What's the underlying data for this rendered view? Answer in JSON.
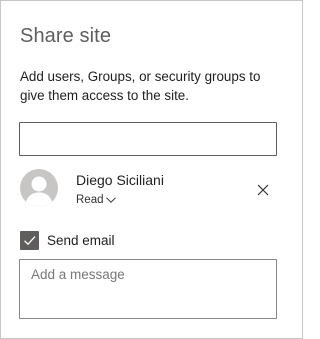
{
  "panel": {
    "title": "Share site",
    "description": "Add users, Groups, or security groups to give them access to the site."
  },
  "people_picker": {
    "value": "",
    "placeholder": ""
  },
  "shared_with": [
    {
      "name": "Diego Siciliani",
      "permission": "Read",
      "avatar_icon": "person-icon",
      "remove_icon": "close-icon"
    }
  ],
  "send_email": {
    "label": "Send email",
    "checked": true,
    "icon": "checkmark-icon"
  },
  "message": {
    "value": "",
    "placeholder": "Add a message"
  },
  "colors": {
    "checkbox_fill": "#605e5c",
    "avatar_bg": "#c8c6c4",
    "title_text": "#605e5c",
    "border": "#c8c6c4"
  }
}
